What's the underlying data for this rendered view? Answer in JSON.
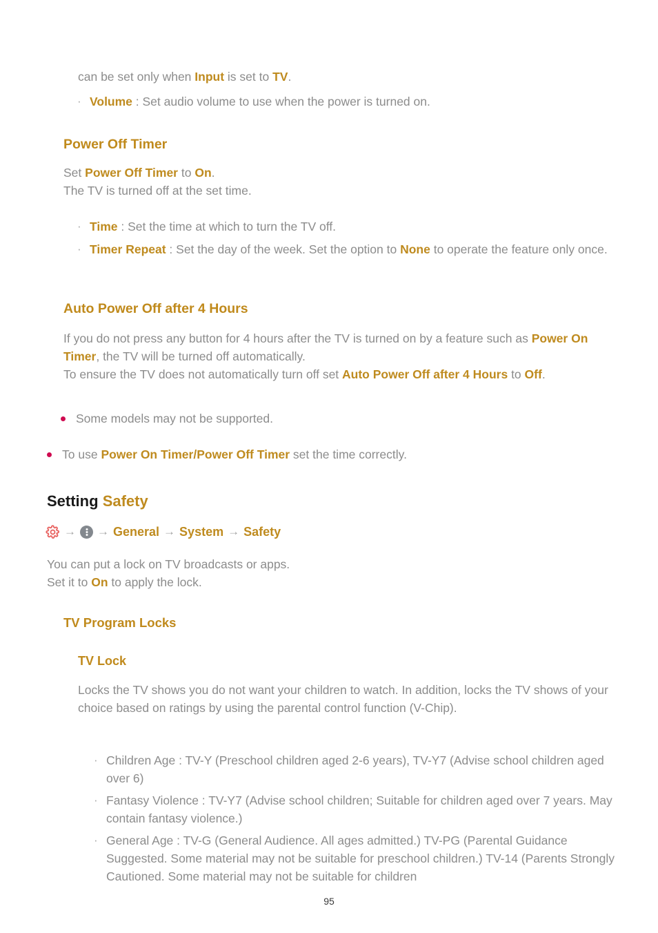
{
  "page": {
    "number": "95",
    "colors": {
      "gold": "#bf8b1f",
      "body_gray": "#8c8c8c",
      "bullet_crimson": "#cf0a50",
      "icon_gear_red": "#e8615f",
      "icon_circle_gray": "#83888e",
      "black": "#1a1a1a"
    }
  },
  "continued_paragraph": {
    "line1_pre": "can be set only when ",
    "line1_term": "Input",
    "line1_mid": " is set to ",
    "line1_term2": "TV",
    "line1_post": "."
  },
  "volume_item": {
    "marker": "·",
    "term": "Volume",
    "rest": " : Set audio volume to use when the power is turned on."
  },
  "power_off_timer": {
    "heading": "Power Off Timer",
    "para_pre": "Set ",
    "para_term": "Power Off Timer",
    "para_mid": " to ",
    "para_term2": "On",
    "para_post": ".",
    "para_line2": "The TV is turned off at the set time.",
    "items": [
      {
        "marker": "·",
        "term": "Time",
        "rest": " : Set the time at which to turn the TV off."
      },
      {
        "marker": "·",
        "term": "Timer Repeat",
        "rest_pre": " : Set the day of the week. Set the option to ",
        "rest_term": "None",
        "rest_post": " to operate the feature only once."
      }
    ]
  },
  "auto_power_off": {
    "heading": "Auto Power Off after 4 Hours",
    "para_pre": "If you do not press any button for 4 hours after the TV is turned on by a feature such as ",
    "para_term": "Power On Timer",
    "para_post": ", the TV will be turned off automatically.",
    "para2_pre": "To ensure the TV does not automatically turn off set ",
    "para2_term": "Auto Power Off after 4 Hours",
    "para2_mid": " to ",
    "para2_term2": "Off",
    "para2_post": ".",
    "note": "Some models may not be supported."
  },
  "timer_note": {
    "pre": "To use ",
    "term1": "Power On Timer",
    "slash": "/",
    "term2": "Power Off Timer",
    "post": " set the time correctly."
  },
  "setting_safety": {
    "heading_black": "Setting",
    "heading_gold": "Safety",
    "breadcrumb": {
      "gear_icon": "gear-icon",
      "dots_icon": "vertical-ellipsis-icon",
      "arrow": "→",
      "crumbs": [
        "General",
        "System",
        "Safety"
      ]
    },
    "intro_line1": "You can put a lock on TV broadcasts or apps.",
    "intro_line2_pre": "Set it to ",
    "intro_line2_term": "On",
    "intro_line2_post": " to apply the lock."
  },
  "tv_program_locks": {
    "heading": "TV Program Locks",
    "tv_lock": {
      "heading": "TV Lock",
      "paragraph": "Locks the TV shows you do not want your children to watch. In addition, locks the TV shows of your choice based on ratings by using the parental control function (V-Chip).",
      "items": [
        {
          "marker": "·",
          "text": "Children Age : TV-Y (Preschool children aged 2-6 years), TV-Y7 (Advise school children aged over 6)"
        },
        {
          "marker": "·",
          "text": "Fantasy Violence : TV-Y7 (Advise school children; Suitable for children aged over 7 years. May contain fantasy violence.)"
        },
        {
          "marker": "·",
          "text": "General Age : TV-G (General Audience. All ages admitted.) TV-PG (Parental Guidance Suggested. Some material may not be suitable for preschool children.) TV-14 (Parents Strongly Cautioned. Some material may not be suitable for children"
        }
      ]
    }
  }
}
